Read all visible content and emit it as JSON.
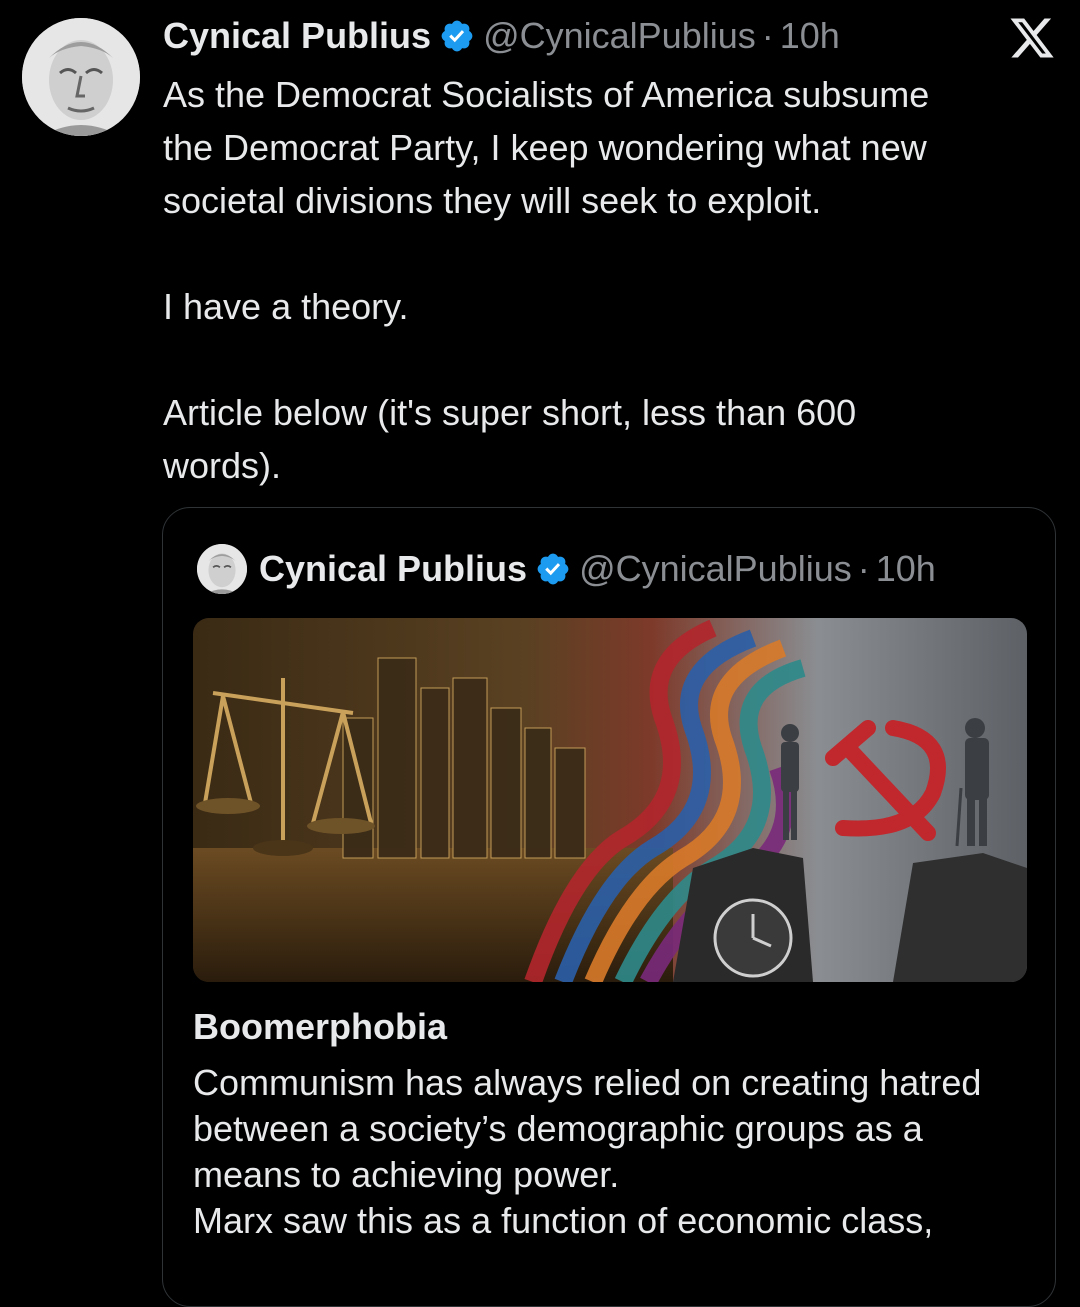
{
  "tweet": {
    "author_name": "Cynical Publius",
    "handle": "@CynicalPublius",
    "separator": "·",
    "time": "10h",
    "body_lines": [
      "As the Democrat Socialists of America subsume",
      "the Democrat Party, I keep wondering what new",
      "societal divisions they will seek to exploit.",
      "",
      "I have a theory.",
      "",
      "Article below (it's super short, less than  600",
      "words)."
    ]
  },
  "quoted": {
    "author_name": "Cynical Publius",
    "handle": "@CynicalPublius",
    "separator": "·",
    "time": "10h",
    "article_title": "Boomerphobia",
    "article_lines": [
      "Communism has always relied on creating hatred",
      "between a society’s demographic groups as a",
      "means to achieving power.",
      "Marx saw this as a function of economic class,"
    ]
  },
  "icons": {
    "verified": "verified-badge-icon",
    "x_logo": "x-logo-icon"
  },
  "colors": {
    "background": "#000000",
    "text": "#e7e9ea",
    "secondary": "#8b8f94",
    "verified": "#1d9bf0",
    "border": "#2f3336"
  }
}
